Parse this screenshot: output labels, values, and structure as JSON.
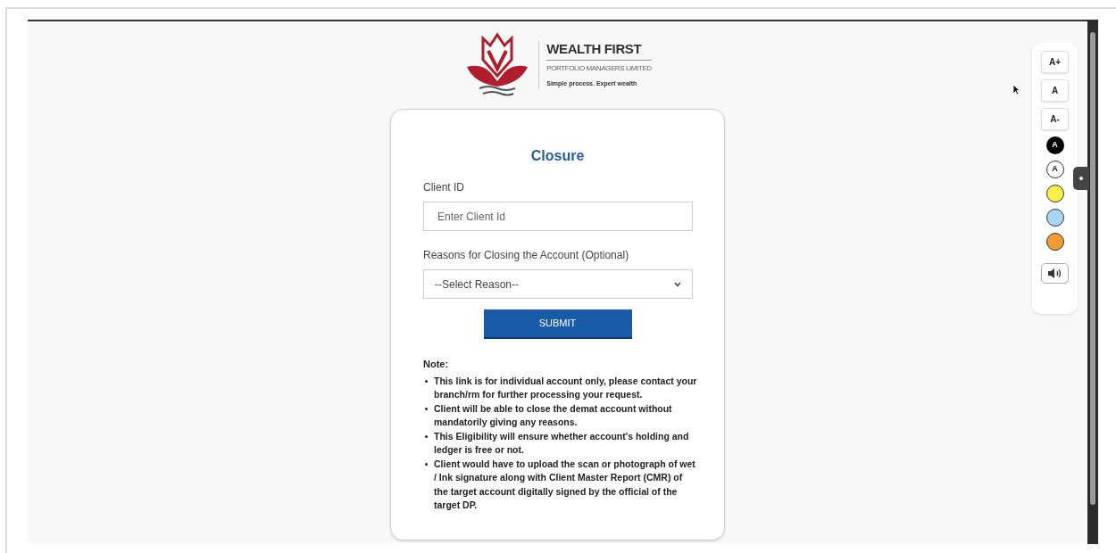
{
  "logo": {
    "name": "WEALTH FIRST",
    "subtitle": "PORTFOLIO MANAGERS LIMITED",
    "tagline": "Simple process. Expert wealth"
  },
  "form": {
    "title": "Closure",
    "client_id": {
      "label": "Client ID",
      "placeholder": "Enter Client Id"
    },
    "reason": {
      "label": "Reasons for Closing the Account (Optional)",
      "value": "--Select Reason--"
    },
    "submit": "SUBMIT",
    "note_heading": "Note:",
    "notes": [
      "This link is for individual account only, please contact your branch/rm for further processing your request.",
      "Client will be able to close the demat account without mandatorily giving any reasons.",
      "This Eligibility will ensure whether account's holding and ledger is free or not.",
      "Client would have to upload the scan or photograph of wet / Ink signature along with Client Master Report (CMR) of the target account digitally signed by the official of the target DP."
    ]
  },
  "accessibility_toolbar": [
    {
      "kind": "text",
      "label": "A+"
    },
    {
      "kind": "text",
      "label": "A"
    },
    {
      "kind": "text",
      "label": "A-"
    },
    {
      "kind": "dark",
      "label": "A"
    },
    {
      "kind": "light",
      "label": "A"
    },
    {
      "kind": "swatch",
      "color": "#fdf04a"
    },
    {
      "kind": "swatch",
      "color": "#a9d6f5"
    },
    {
      "kind": "swatch",
      "color": "#f29a33"
    },
    {
      "kind": "speaker"
    }
  ]
}
